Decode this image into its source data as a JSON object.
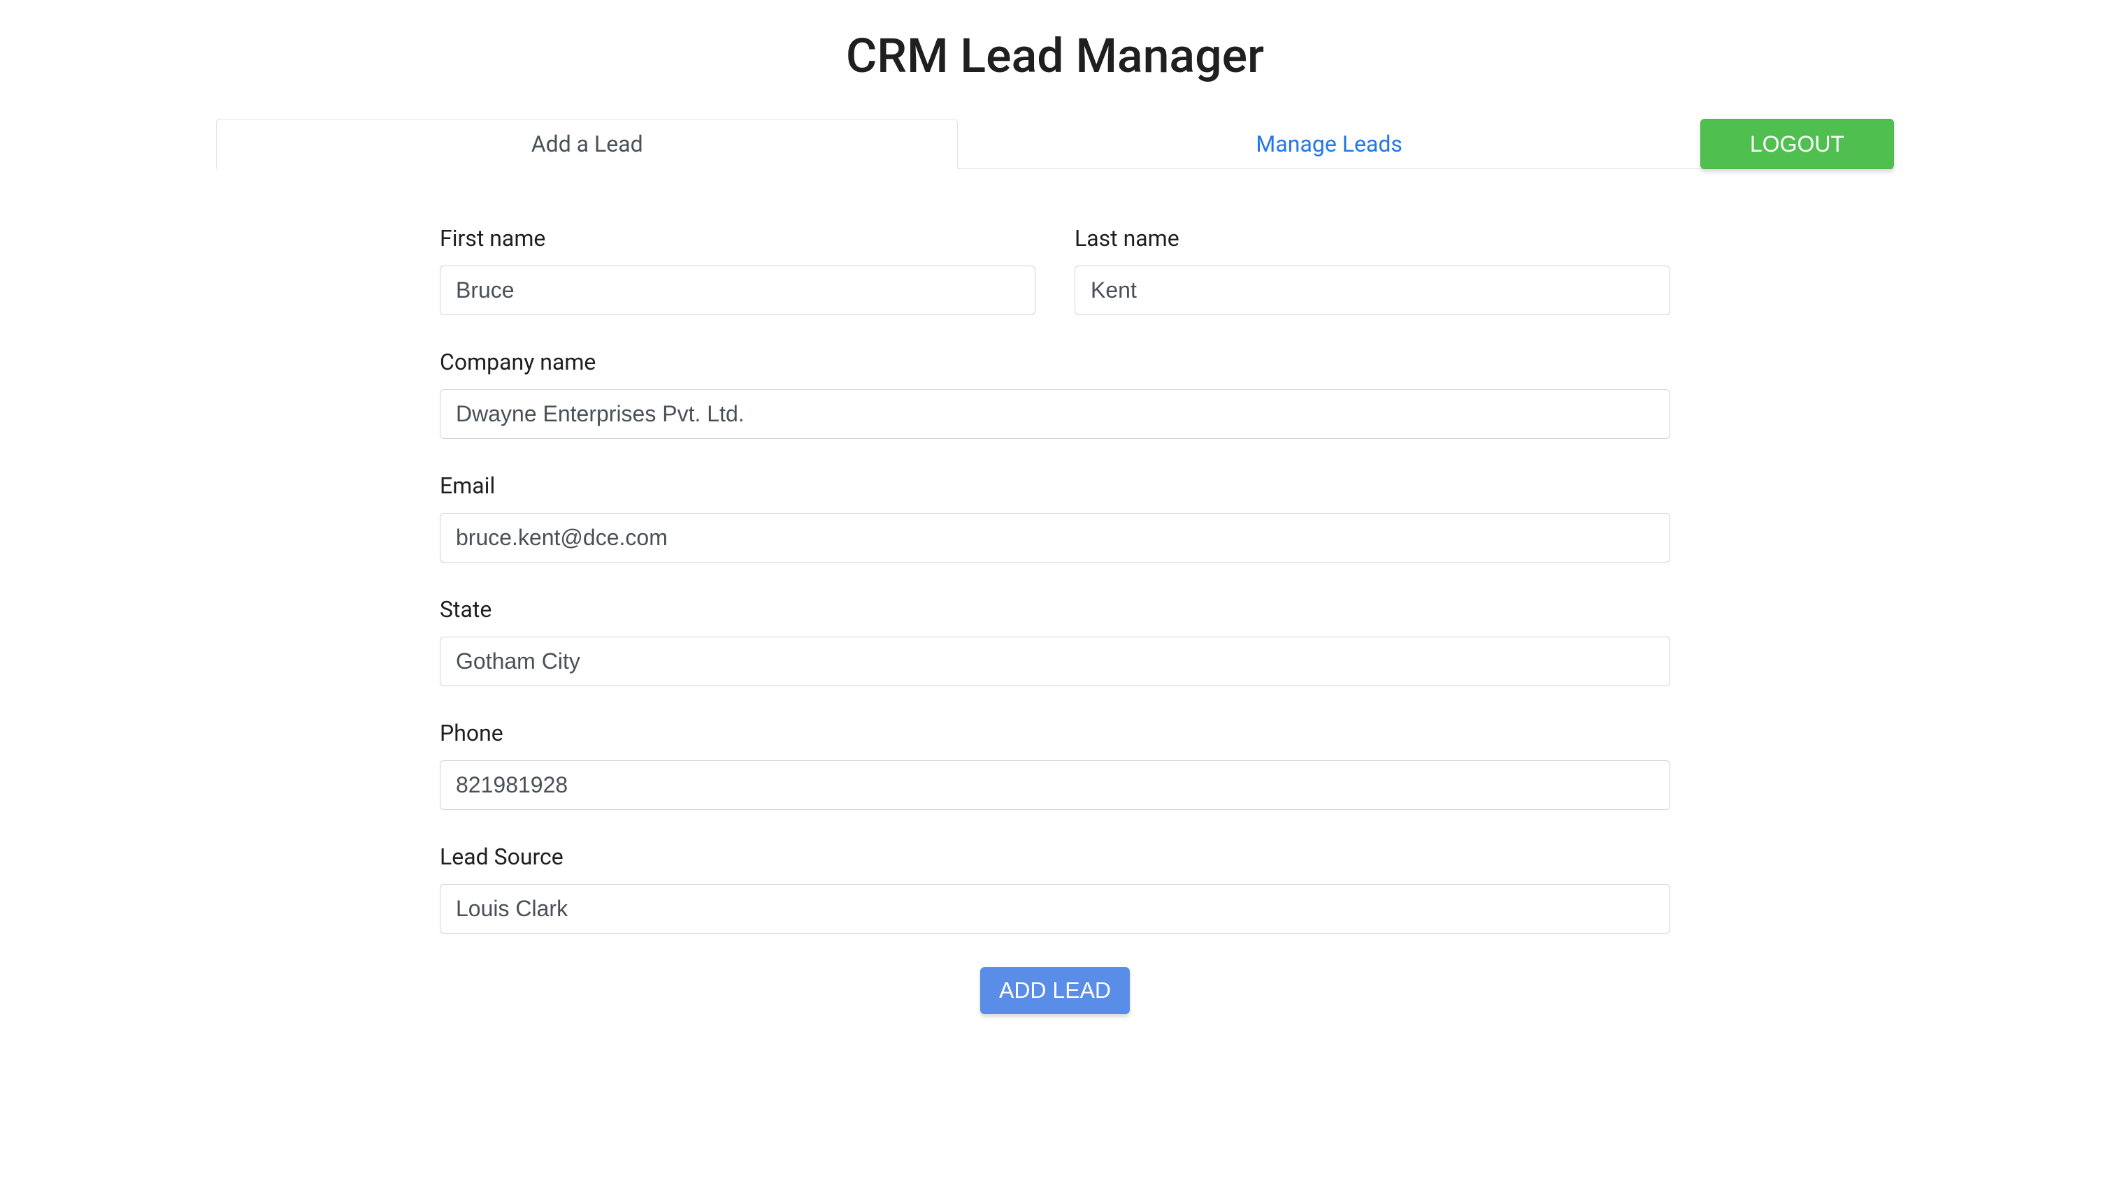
{
  "title": "CRM Lead Manager",
  "tabs": {
    "add_lead": "Add a Lead",
    "manage_leads": "Manage Leads"
  },
  "logout_label": "LOGOUT",
  "form": {
    "first_name": {
      "label": "First name",
      "value": "Bruce"
    },
    "last_name": {
      "label": "Last name",
      "value": "Kent"
    },
    "company_name": {
      "label": "Company name",
      "value": "Dwayne Enterprises Pvt. Ltd."
    },
    "email": {
      "label": "Email",
      "value": "bruce.kent@dce.com"
    },
    "state": {
      "label": "State",
      "value": "Gotham City"
    },
    "phone": {
      "label": "Phone",
      "value": "821981928"
    },
    "lead_source": {
      "label": "Lead Source",
      "value": "Louis Clark"
    }
  },
  "submit_label": "ADD LEAD"
}
